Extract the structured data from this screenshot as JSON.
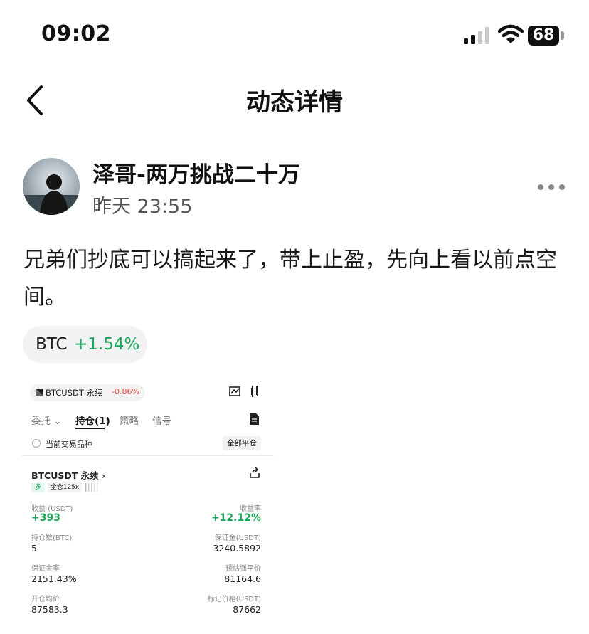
{
  "status_bar": {
    "time": "09:02",
    "battery": "68"
  },
  "nav": {
    "title": "动态详情"
  },
  "post": {
    "author": "泽哥-两万挑战二十万",
    "time": "昨天 23:55",
    "content": "兄弟们抄底可以搞起来了，带上止盈，先向上看以前点空间。",
    "tag": {
      "symbol": "BTC",
      "change": "+1.54%"
    }
  },
  "screenshot": {
    "symbol_pill": {
      "symbol": "BTCUSDT 永续",
      "change": "-0.86%"
    },
    "tabs": [
      "委托",
      "持仓(1)",
      "策略",
      "信号"
    ],
    "current_only_label": "当前交易品种",
    "close_all_label": "全部平仓",
    "position": {
      "symbol": "BTCUSDT 永续 ›",
      "side": "多",
      "leverage": "全仓125x",
      "pnl_label": "收益 (USDT)",
      "pnl_value": "+393",
      "roe_label": "收益率",
      "roe_value": "+12.12%",
      "qty_label": "持仓数(BTC)",
      "qty_value": "5",
      "margin_label": "保证金(USDT)",
      "margin_value": "3240.5892",
      "margin_ratio_label": "保证金率",
      "margin_ratio_value": "2151.43%",
      "liq_label": "预估强平价",
      "liq_value": "81164.6",
      "entry_label": "开仓均价",
      "entry_value": "87583.3",
      "mark_label": "标记价格(USDT)",
      "mark_value": "87662"
    }
  },
  "colors": {
    "up": "#1ea85c",
    "down": "#e84c3d"
  },
  "icons": [
    "signal-icon",
    "wifi-icon",
    "back-chevron-icon",
    "more-icon",
    "chart-icon",
    "candlestick-icon",
    "document-icon",
    "share-icon"
  ]
}
